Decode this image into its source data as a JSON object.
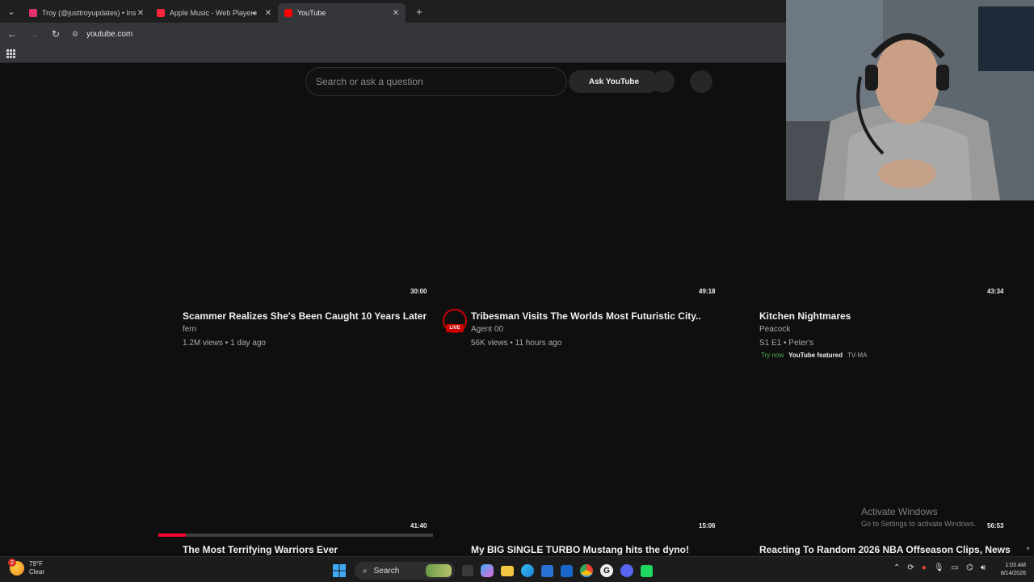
{
  "browser": {
    "tabs": [
      {
        "title": "Troy (@justtroyupdates) • Instag",
        "favicon_color": "#e1306c",
        "audio": false,
        "active": false
      },
      {
        "title": "Apple Music - Web Player",
        "favicon_color": "#fa243c",
        "audio": true,
        "active": false
      },
      {
        "title": "YouTube",
        "favicon_color": "#ff0000",
        "audio": false,
        "active": true
      }
    ],
    "url": "youtube.com"
  },
  "youtube": {
    "search_placeholder": "Search or ask a question",
    "ask_button": "Ask YouTube",
    "videos": [
      {
        "title": "Scammer Realizes She's Been Caught 10 Years Later",
        "channel": "fern",
        "meta": "1.2M views • 1 day ago",
        "duration": "30:00"
      },
      {
        "title": "Tribesman Visits The Worlds Most Futuristic City..",
        "channel": "Agent 00",
        "meta": "56K views • 11 hours ago",
        "duration": "49:18",
        "live_label": "LIVE"
      },
      {
        "title": "Kitchen Nightmares",
        "channel": "Peacock",
        "meta": "S1 E1 • Peter's",
        "duration": "43:34",
        "badges": {
          "try": "Try now",
          "featured": "YouTube featured",
          "rating": "TV-MA"
        }
      },
      {
        "title": "The Most Terrifying Warriors Ever",
        "duration": "41:40",
        "progress": 0.1
      },
      {
        "title": "My BIG SINGLE TURBO Mustang hits the dyno!",
        "duration": "15:06"
      },
      {
        "title": "Reacting To Random 2026 NBA Offseason Clips, News",
        "duration": "56:53"
      }
    ]
  },
  "watermark": {
    "line1": "Activate Windows",
    "line2": "Go to Settings to activate Windows."
  },
  "taskbar": {
    "weather_temp": "79°F",
    "weather_cond": "Clear",
    "weather_badge": "2",
    "search_label": "Search",
    "time": "1:03 AM",
    "date": "8/14/2026"
  },
  "colors": {
    "background": "#0f0f0f",
    "accent_red": "#ff0033",
    "try_now_green": "#4caf50"
  }
}
